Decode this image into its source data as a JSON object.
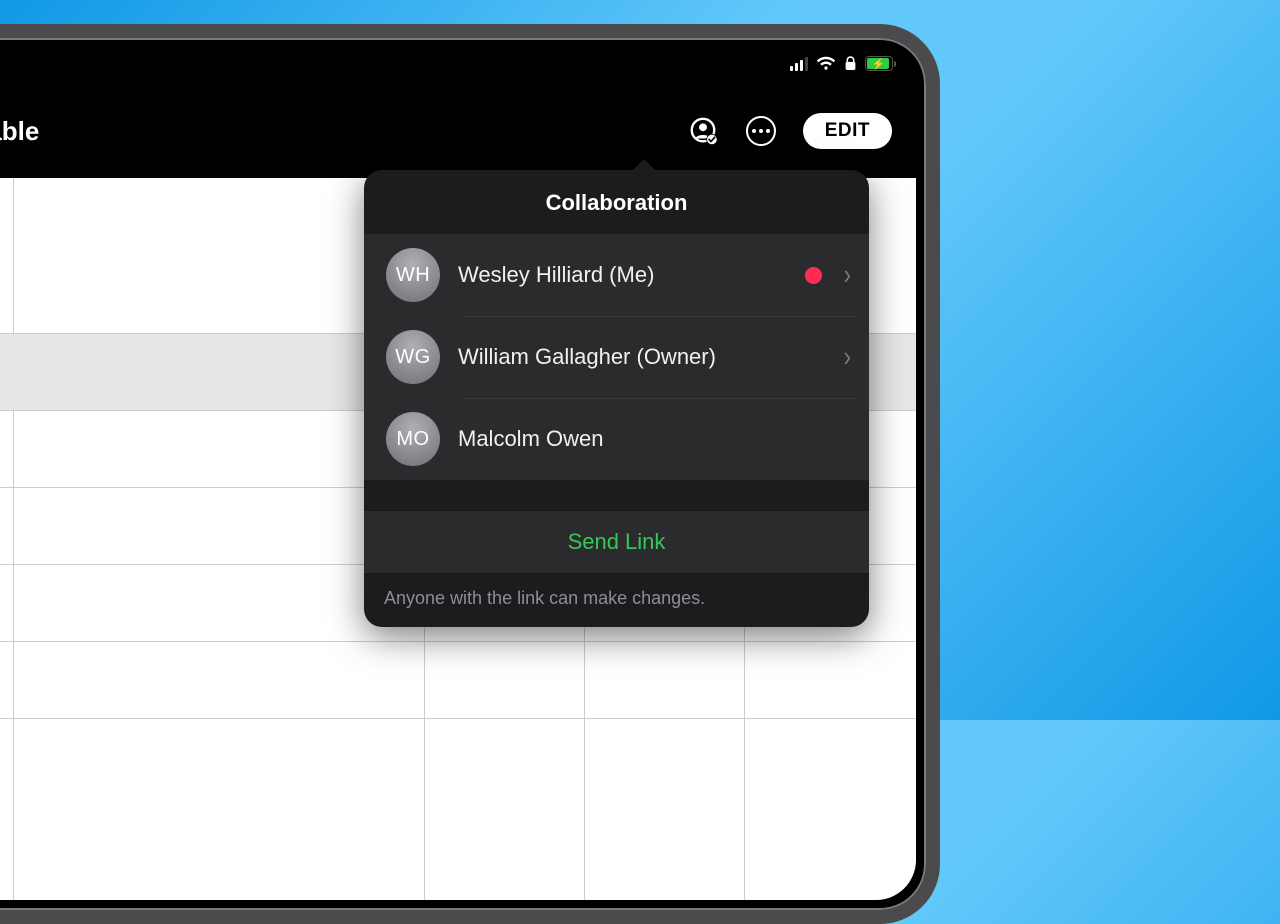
{
  "toolbar": {
    "title_fragment": "r Table",
    "edit_label": "EDIT"
  },
  "status": {
    "signal_bars_active": 3,
    "wifi": true,
    "orientation_lock": true,
    "battery_percent": 88,
    "charging": true
  },
  "popover": {
    "title": "Collaboration",
    "people": [
      {
        "initials": "WH",
        "name": "Wesley Hilliard (Me)",
        "color_dot": "#ff2d55",
        "disclosure": true
      },
      {
        "initials": "WG",
        "name": "William Gallagher (Owner)",
        "color_dot": null,
        "disclosure": true
      },
      {
        "initials": "MO",
        "name": "Malcolm Owen",
        "color_dot": null,
        "disclosure": false
      }
    ],
    "send_link_label": "Send Link",
    "caption": "Anyone with the link can make changes."
  }
}
